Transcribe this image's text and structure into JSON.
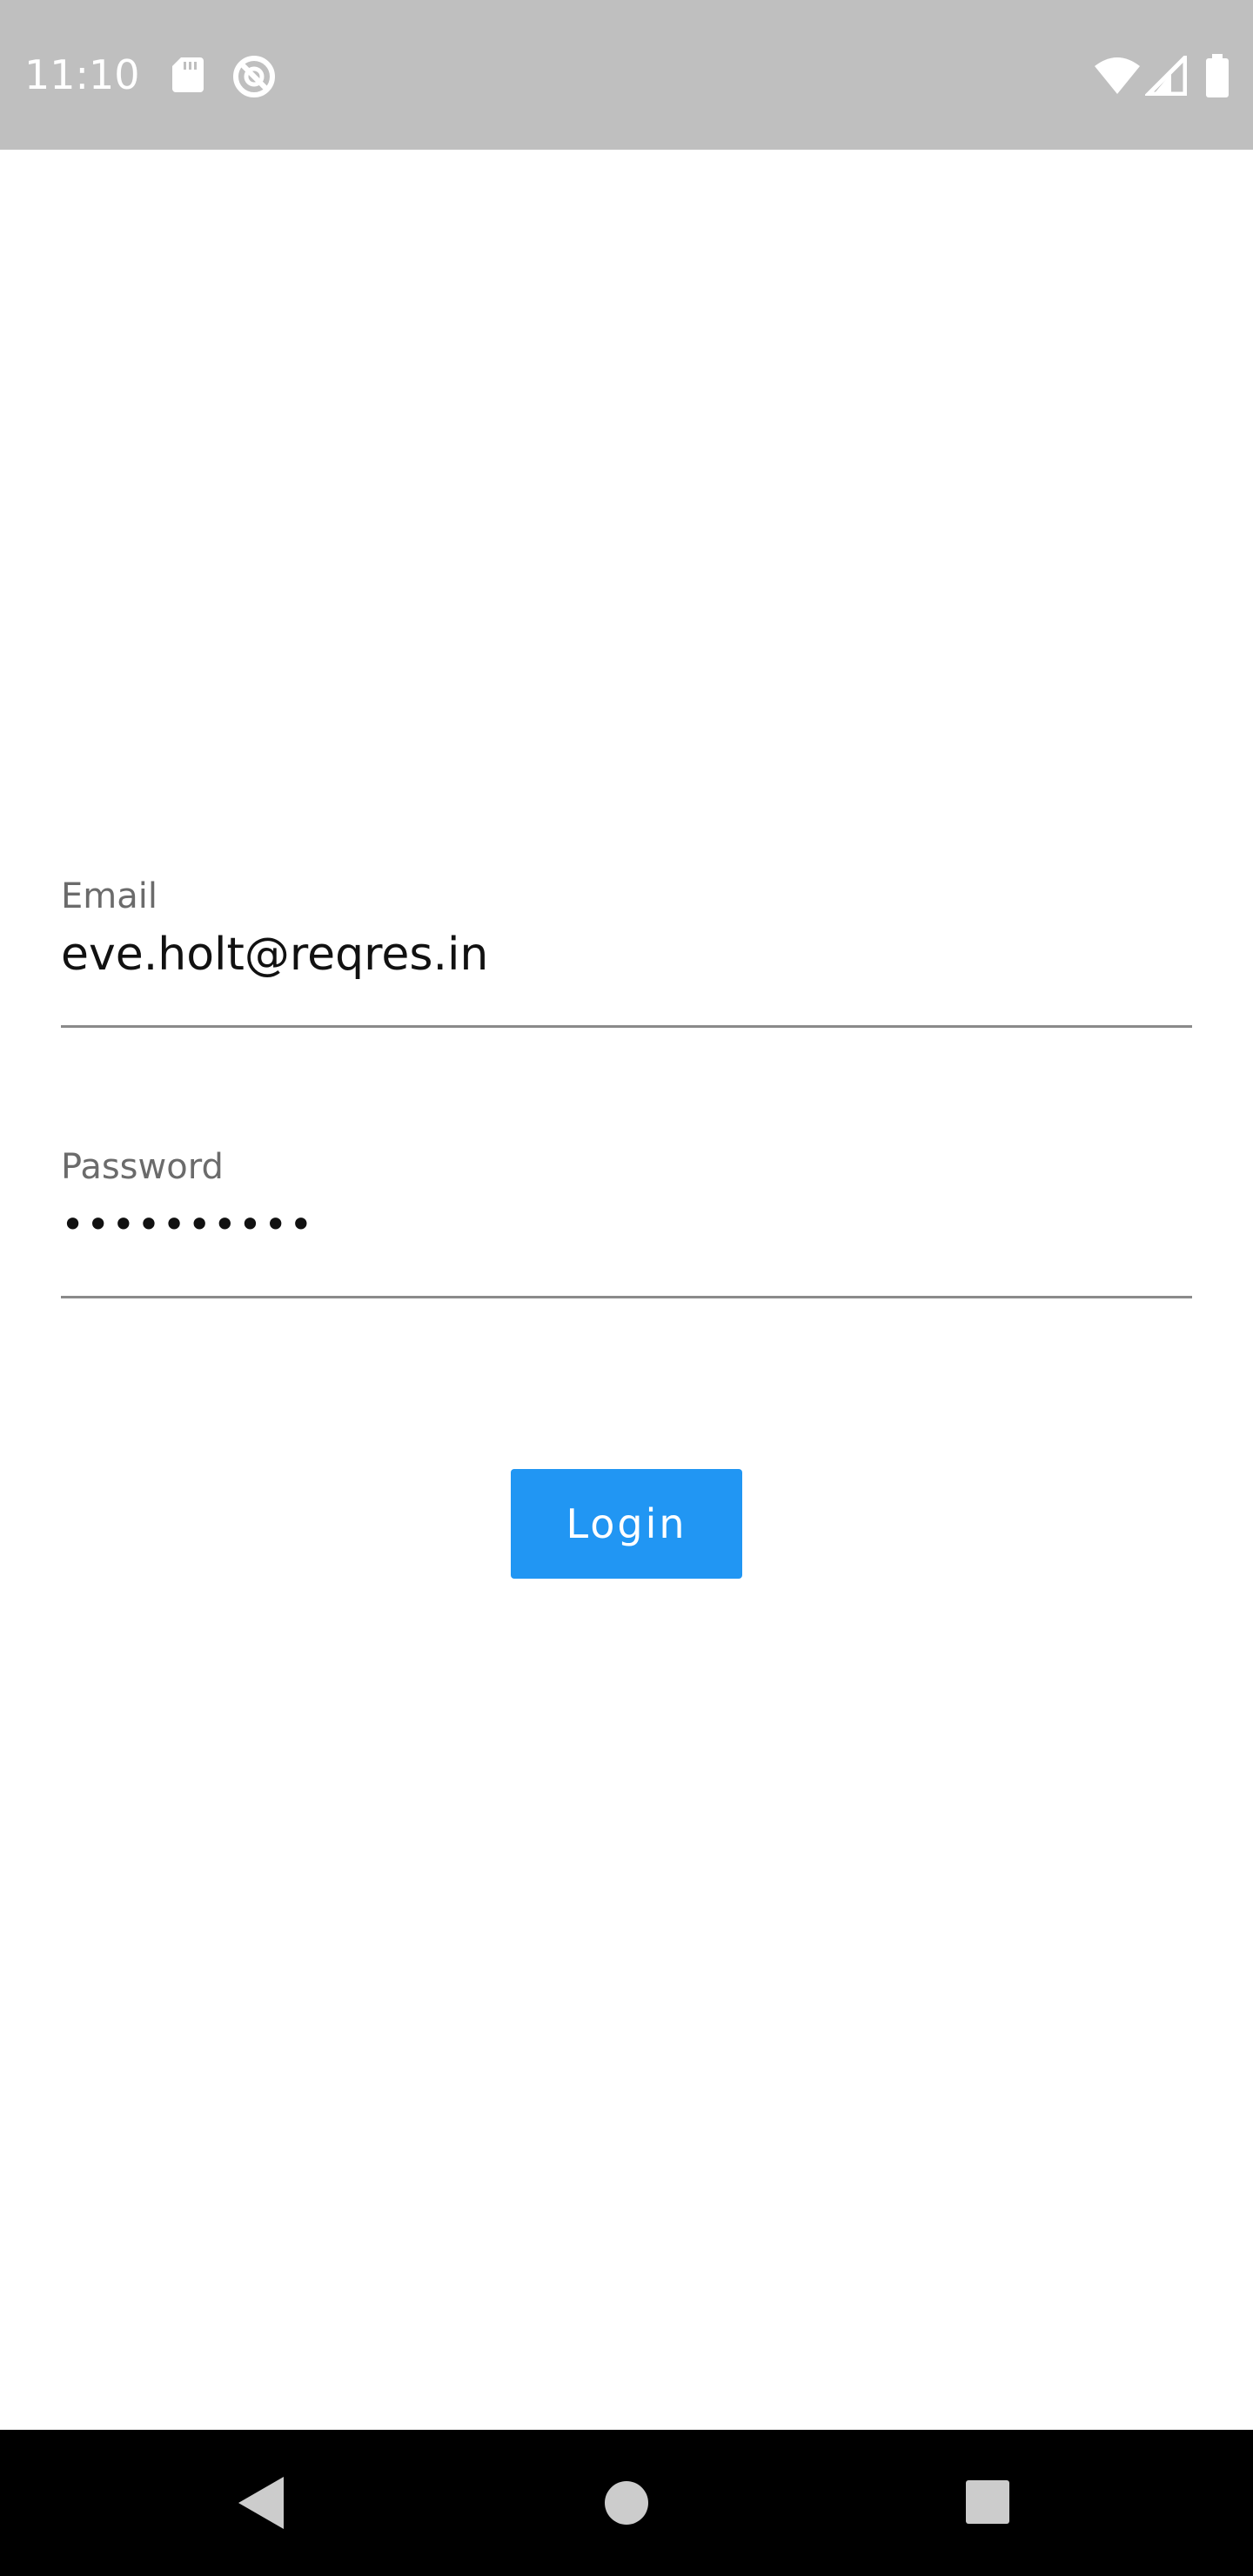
{
  "status_bar": {
    "time": "11:10",
    "icons": [
      "sd-card-icon",
      "do-not-disturb-icon",
      "wifi-icon",
      "cell-signal-icon",
      "battery-icon"
    ]
  },
  "login_form": {
    "email": {
      "label": "Email",
      "value": "eve.holt@reqres.in"
    },
    "password": {
      "label": "Password",
      "value": "••••••••••"
    },
    "login_button_label": "Login"
  },
  "colors": {
    "status_bar_bg": "#bfbfbf",
    "accent": "#2196f3",
    "nav_bar_bg": "#000000"
  },
  "nav_bar": {
    "icons": [
      "back-icon",
      "home-icon",
      "recents-icon"
    ]
  }
}
